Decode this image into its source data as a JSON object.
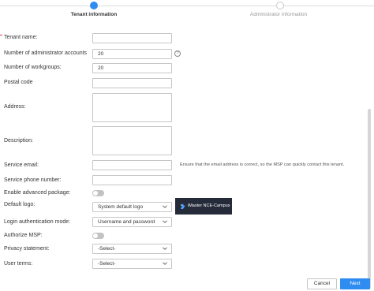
{
  "steps": [
    {
      "label": "Tenant information",
      "state": "active"
    },
    {
      "label": "Administrator information",
      "state": "todo"
    }
  ],
  "form": {
    "tenant_name": {
      "label": "Tenant name:",
      "value": ""
    },
    "admin_accounts": {
      "label": "Number of administrator accounts",
      "value": "20",
      "help_icon": "question-circle-icon",
      "help_glyph": "?"
    },
    "workgroups": {
      "label": "Number of workgroups:",
      "value": "20"
    },
    "postal_code": {
      "label": "Postal code",
      "value": ""
    },
    "address": {
      "label": "Address:",
      "value": ""
    },
    "description": {
      "label": "Description:",
      "value": ""
    },
    "service_email": {
      "label": "Service email:",
      "value": "",
      "hint": "Ensure that the email address is correct, so the MSP can quickly contact this tenant."
    },
    "service_phone": {
      "label": "Service phone number:",
      "value": ""
    },
    "advanced_package": {
      "label": "Enable advanced package:",
      "enabled": false
    },
    "default_logo": {
      "label": "Default logo:",
      "value": "System default logo",
      "preview_text": "iMaster NCE-Campus"
    },
    "login_auth": {
      "label": "Login authentication mode:",
      "value": "Username and password"
    },
    "authorize_msp": {
      "label": "Authorize MSP:",
      "enabled": false
    },
    "privacy_statement": {
      "label": "Privacy statement:",
      "value": "-Select-"
    },
    "user_terms": {
      "label": "User terms:",
      "value": "-Select-"
    }
  },
  "footer": {
    "cancel_label": "Cancel",
    "next_label": "Next"
  },
  "colors": {
    "accent": "#2f8cf0",
    "logo_bg": "#262b3a",
    "required": "#e04040"
  }
}
